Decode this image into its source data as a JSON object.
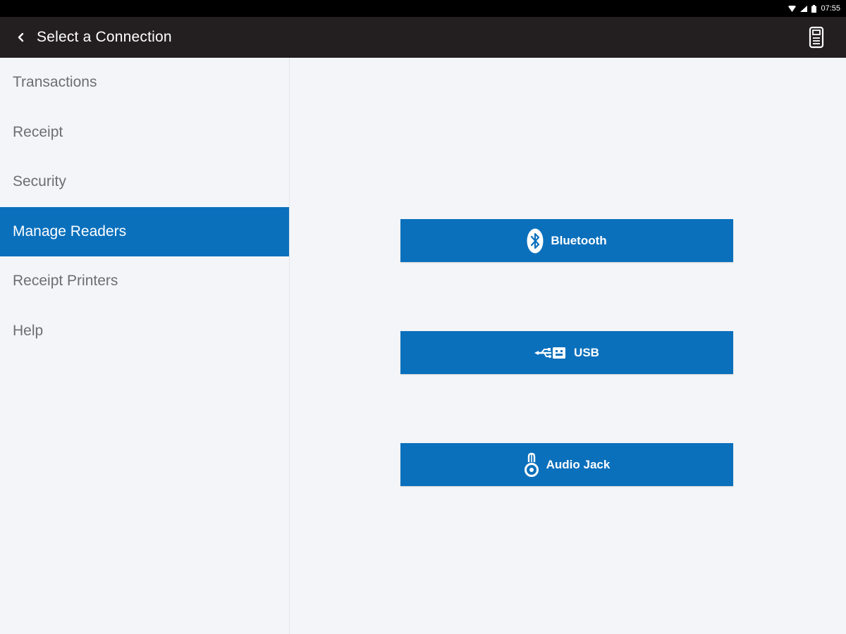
{
  "status_bar": {
    "time": "07:55",
    "icons": [
      "wifi-icon",
      "signal-icon",
      "battery-icon"
    ]
  },
  "app_bar": {
    "back_icon": "chevron-left-icon",
    "title": "Select a Connection",
    "action_icon": "card-reader-icon"
  },
  "sidebar": {
    "items": [
      {
        "label": "Transactions",
        "active": false
      },
      {
        "label": "Receipt",
        "active": false
      },
      {
        "label": "Security",
        "active": false
      },
      {
        "label": "Manage Readers",
        "active": true
      },
      {
        "label": "Receipt Printers",
        "active": false
      },
      {
        "label": "Help",
        "active": false
      }
    ]
  },
  "connections": [
    {
      "label": "Bluetooth",
      "icon": "bluetooth-icon"
    },
    {
      "label": "USB",
      "icon": "usb-icon"
    },
    {
      "label": "Audio Jack",
      "icon": "audio-jack-icon"
    }
  ],
  "colors": {
    "accent": "#0a70bc",
    "app_bar": "#231f20",
    "background": "#f3f5f8",
    "sidebar_text": "#6d6e71"
  }
}
